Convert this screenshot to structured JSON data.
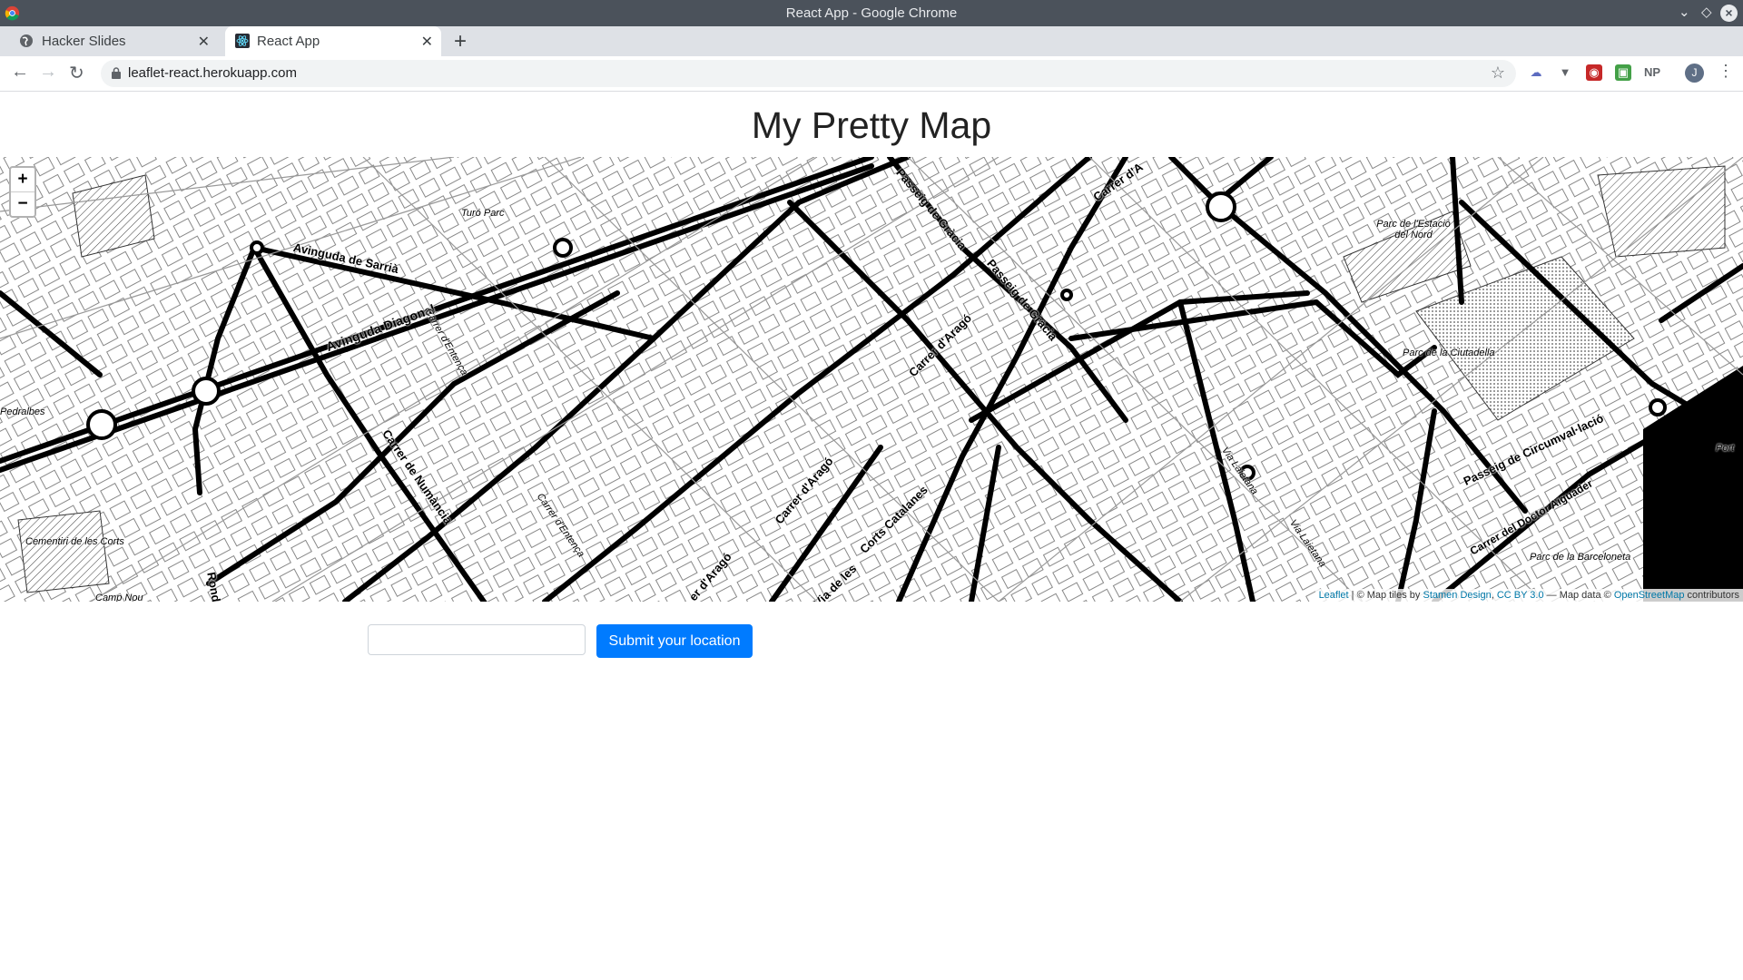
{
  "window": {
    "title": "React App - Google Chrome"
  },
  "tabs": [
    {
      "label": "Hacker Slides",
      "active": false
    },
    {
      "label": "React App",
      "active": true
    }
  ],
  "toolbar": {
    "url": "leaflet-react.herokuapp.com",
    "profile_initial": "J",
    "ext_np": "NP"
  },
  "page": {
    "title": "My Pretty Map",
    "location_input": {
      "value": "",
      "placeholder": ""
    },
    "submit_label": "Submit your location"
  },
  "map": {
    "zoom_in": "+",
    "zoom_out": "−",
    "attribution": {
      "leaflet": "Leaflet",
      "sep1": " | © Map tiles by ",
      "stamen": "Stamen Design",
      "sep2": ", ",
      "license": "CC BY 3.0",
      "sep3": " — Map data © ",
      "osm": "OpenStreetMap",
      "tail": " contributors"
    },
    "labels": {
      "turo_parc": "Turó Parc",
      "av_sarria": "Avinguda de Sarrià",
      "av_diagonal": "Avinguda Diagonal",
      "entenca1": "Carrer d'Entença",
      "entenca2": "Carrer d'Entença",
      "numancia": "Carrer de Numància",
      "pedralbes": "Pedralbes",
      "cementiri": "Cementiri de les Corts",
      "camp_nou": "Camp Nou",
      "ronda": "Ronda",
      "passeig_gracia1": "Passeig de Gràcia",
      "passeig_gracia2": "Passeig de Gràcia",
      "arago1": "Carrer d'Aragó",
      "arago2": "Carrer d'Aragó",
      "arago3": "er d'Aragó",
      "corts_catalanes": "Corts Catalanes",
      "via_de_les": "Via de les",
      "carrer_d_a": "Carrer d'A",
      "via_laietana1": "Via Laietana",
      "via_laietana2": "Via Laietana",
      "parc_estacio": "Parc de l'Estació del Nord",
      "parc_ciutadella": "Parc de la Ciutadella",
      "circumval": "Passeig de Circumval·lació",
      "doctor_aiguader": "Carrer del Doctor Aiguader",
      "parc_barceloneta": "Parc de la Barceloneta",
      "port": "Port"
    }
  },
  "colors": {
    "accent": "#007bff",
    "titlebar": "#4b525b",
    "tabstrip": "#dee1e6"
  }
}
